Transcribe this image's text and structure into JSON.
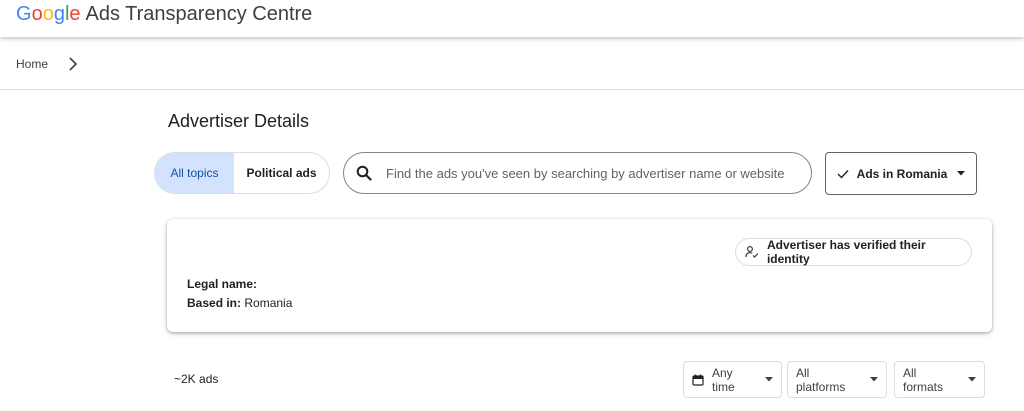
{
  "header": {
    "logo_letters": [
      {
        "char": "G",
        "color": "#4285F4"
      },
      {
        "char": "o",
        "color": "#EA4335"
      },
      {
        "char": "o",
        "color": "#FBBC05"
      },
      {
        "char": "g",
        "color": "#4285F4"
      },
      {
        "char": "l",
        "color": "#34A853"
      },
      {
        "char": "e",
        "color": "#EA4335"
      }
    ],
    "app_name": "Ads Transparency Centre"
  },
  "breadcrumb": {
    "home_label": "Home",
    "chevron_icon": "chevron-right-icon"
  },
  "page": {
    "title": "Advertiser Details"
  },
  "topics": {
    "options": [
      "All topics",
      "Political ads"
    ],
    "selected": "All topics",
    "accent_bg": "#d3e3fd"
  },
  "search": {
    "placeholder": "Find the ads you've seen by searching by advertiser name or website",
    "value": "",
    "icon": "search-icon"
  },
  "region": {
    "label": "Ads in Romania",
    "check_icon": "check-icon",
    "caret_icon": "caret-down-icon"
  },
  "advertiser": {
    "verified_label": "Advertiser has verified their identity",
    "verified_icon": "verified-person-icon",
    "legal_name_label": "Legal name:",
    "legal_name_value": "",
    "based_in_label": "Based in:",
    "based_in_value": "Romania"
  },
  "results": {
    "count_label": "~2K ads"
  },
  "filters": {
    "time": {
      "label": "Any time",
      "icon": "calendar-icon"
    },
    "platforms": {
      "label": "All platforms"
    },
    "formats": {
      "label": "All formats"
    }
  }
}
